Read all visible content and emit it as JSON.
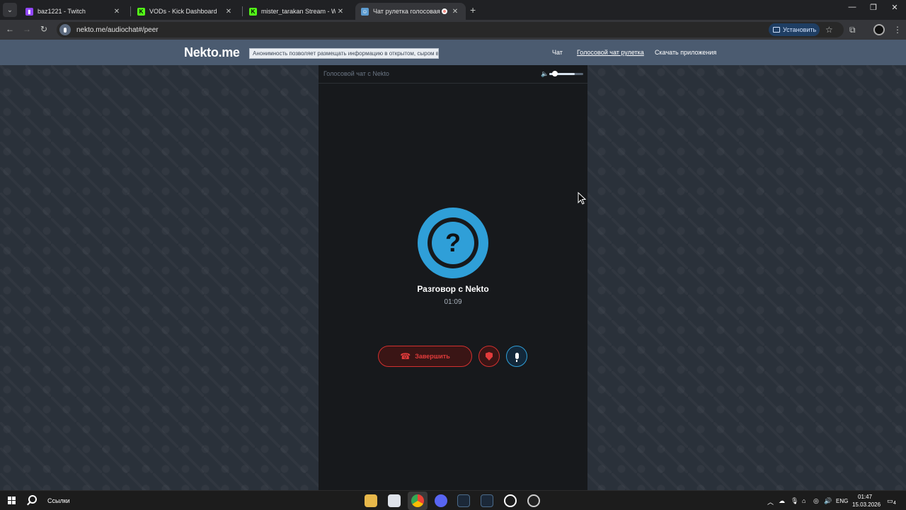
{
  "browser": {
    "tabs": [
      {
        "title": "baz1221 - Twitch",
        "favicon": "twitch-icon",
        "color": "#9146ff",
        "active": false
      },
      {
        "title": "VODs - Kick Dashboard",
        "favicon": "kick-icon",
        "color": "#53fc18",
        "active": false
      },
      {
        "title": "mister_tarakan Stream - Watch",
        "favicon": "kick-icon",
        "color": "#53fc18",
        "active": false
      },
      {
        "title": "Чат рулетка голосовая — ",
        "favicon": "nekto-icon",
        "color": "#5d9cd1",
        "active": true
      }
    ],
    "address": "nekto.me/audiochat#/peer",
    "install_label": "Установить"
  },
  "site": {
    "logo": "Nekto.me",
    "notice": "Анонимность позволяет размещать информацию в открытом, сыром виде!",
    "nav": [
      "Чат",
      "Голосовой чат рулетка",
      "Скачать приложения"
    ]
  },
  "chat": {
    "panel_title": "Голосовой чат с Nekto",
    "volume": 0.75,
    "avatar_symbol": "?",
    "peer_name": "Разговор с Nekto",
    "timer": "01:09",
    "end_label": "Завершить",
    "accent_color": "#2f9fd8",
    "danger_color": "#d3302f"
  },
  "taskbar": {
    "search_label": "Ссылки",
    "lang": "ENG",
    "time": "01:47",
    "date": "15.03.2026",
    "notifications": "4"
  }
}
